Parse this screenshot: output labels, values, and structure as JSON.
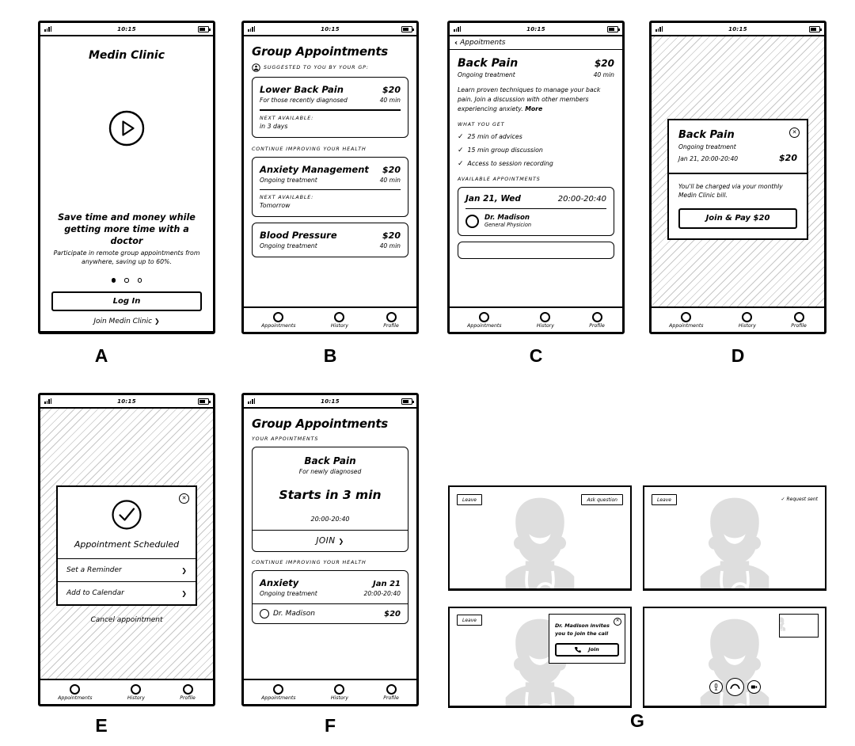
{
  "meta": {
    "status_time": "10:15",
    "nav": [
      "Appointments",
      "History",
      "Profile"
    ]
  },
  "screens": {
    "A": {
      "letter": "A",
      "app_title": "Medin Clinic",
      "play_icon": "play-icon",
      "headline": "Save time and money while getting more time with a doctor",
      "subtext": "Participate in remote group appointments from anywhere, saving up to 60%.",
      "dots": 3,
      "active_dot": 0,
      "login_label": "Log In",
      "join_label": "Join Medin Clinic",
      "join_chevron": "❯"
    },
    "B": {
      "letter": "B",
      "title": "Group Appointments",
      "suggested_label": "SUGGESTED TO YOU BY YOUR GP:",
      "suggested_icon": "person-circle-icon",
      "continue_label": "CONTINUE IMPROVING YOUR HEALTH",
      "next_available_label": "NEXT AVAILABLE:",
      "cards": [
        {
          "title": "Lower Back Pain",
          "price": "$20",
          "sub": "For those recently diagnosed",
          "dur": "40 min",
          "next_label": "NEXT AVAILABLE:",
          "next_value": "in 3 days"
        },
        {
          "title": "Anxiety Management",
          "price": "$20",
          "sub": "Ongoing treatment",
          "dur": "40 min",
          "next_label": "NEXT AVAILABLE:",
          "next_value": "Tomorrow"
        },
        {
          "title": "Blood Pressure",
          "price": "$20",
          "sub": "Ongoing treatment",
          "dur": "40 min"
        }
      ]
    },
    "C": {
      "letter": "C",
      "back_label": "Appoitments",
      "back_chevron": "‹",
      "title": "Back Pain",
      "price": "$20",
      "sub": "Ongoing treatment",
      "dur": "40 min",
      "description": "Learn proven techniques to manage your back pain. Join a discussion with other members experiencing anxiety.",
      "more_link": "More",
      "what_you_get_label": "WHAT YOU GET",
      "benefits": [
        "25 min of advices",
        "15 min group discussion",
        "Access to session recording"
      ],
      "available_label": "AVAILABLE APPOINTMENTS",
      "slot": {
        "date": "Jan 21, Wed",
        "time": "20:00-20:40",
        "doctor": "Dr. Madison",
        "doctor_role": "General Physicion"
      }
    },
    "D": {
      "letter": "D",
      "title": "Back Pain",
      "sub": "Ongoing treatment",
      "datetime": "Jan 21, 20:00-20:40",
      "price": "$20",
      "billing_note": "You'll be charged via your monthly Medin Clinic bill.",
      "cta_label": "Join & Pay $20",
      "close_icon": "close-icon"
    },
    "E": {
      "letter": "E",
      "check_icon": "check-circle-icon",
      "title": "Appointment Scheduled",
      "options": [
        "Set a Reminder",
        "Add to Calendar"
      ],
      "chevron": "❯",
      "cancel_label": "Cancel appointment",
      "close_icon": "close-icon"
    },
    "F": {
      "letter": "F",
      "title": "Group Appointments",
      "your_appointments_label": "YOUR APPOINTMENTS",
      "continue_label": "CONTINUE IMPROVING YOUR HEALTH",
      "upcoming": {
        "title": "Back Pain",
        "sub": "For newly diagnosed",
        "countdown": "Starts in 3 min",
        "time": "20:00-20:40",
        "join_label": "JOIN",
        "join_chevron": "❯"
      },
      "next_card": {
        "title": "Anxiety",
        "date": "Jan 21",
        "sub": "Ongoing treatment",
        "time": "20:00-20:40",
        "doctor": "Dr. Madison",
        "price": "$20"
      }
    },
    "G": {
      "letter": "G",
      "panels": [
        {
          "leave_label": "Leave",
          "action_label": "Ask question"
        },
        {
          "leave_label": "Leave",
          "status_label": "✓ Request sent"
        },
        {
          "leave_label": "Leave",
          "invite_text": "Dr. Madison invites you to join the call",
          "join_label": "Join",
          "phone_icon": "phone-icon",
          "close_icon": "close-icon"
        },
        {
          "self_view": "self-view-thumbnail",
          "controls": [
            "mic-icon",
            "end-call-icon",
            "camera-icon"
          ]
        }
      ]
    }
  }
}
